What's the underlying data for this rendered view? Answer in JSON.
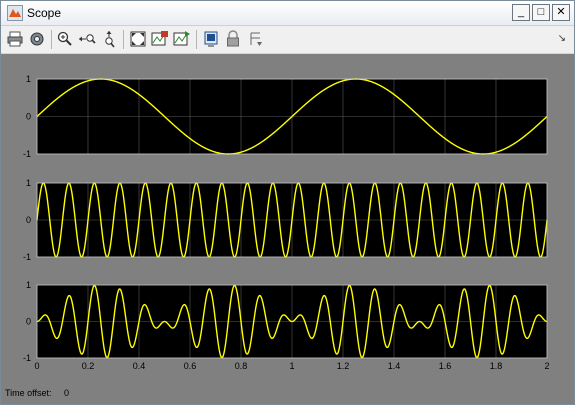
{
  "window": {
    "title": "Scope",
    "controls": [
      "_",
      "□",
      "✕"
    ]
  },
  "toolbar": {
    "buttons": [
      {
        "name": "print-button",
        "icon": "printer-icon"
      },
      {
        "name": "parameters-button",
        "icon": "gear-icon"
      },
      {
        "name": "zoom-in-button",
        "icon": "magnifier-icon"
      },
      {
        "name": "zoom-x-button",
        "icon": "zoom-x-icon"
      },
      {
        "name": "zoom-y-button",
        "icon": "zoom-y-icon"
      },
      {
        "name": "autoscale-button",
        "icon": "autoscale-icon"
      },
      {
        "name": "save-axes-button",
        "icon": "save-axes-icon"
      },
      {
        "name": "restore-axes-button",
        "icon": "restore-axes-icon"
      },
      {
        "name": "floating-scope-button",
        "icon": "floating-icon"
      },
      {
        "name": "lock-axes-button",
        "icon": "lock-icon"
      },
      {
        "name": "signal-selection-button",
        "icon": "signal-selection-icon"
      }
    ],
    "corner_glyph": "↘"
  },
  "status": {
    "time_offset_label": "Time offset:",
    "time_offset_value": "0"
  },
  "colors": {
    "plot_background": "#000000",
    "figure_background": "#808080",
    "trace": "#ffff00",
    "grid": "#5a5a5a",
    "tick_text": "#000000"
  },
  "chart_data": [
    {
      "type": "line",
      "title": "",
      "xlabel": "",
      "ylabel": "",
      "xlim": [
        0,
        2
      ],
      "ylim": [
        -1,
        1
      ],
      "xticks": [
        0,
        0.2,
        0.4,
        0.6,
        0.8,
        1,
        1.2,
        1.4,
        1.6,
        1.8,
        2
      ],
      "yticks": [
        -1,
        0,
        1
      ],
      "x_tick_labels_shown": false,
      "grid": true,
      "series": [
        {
          "function": "sin(2*pi*1*t)",
          "frequency_hz": 1,
          "amplitude": 1
        }
      ]
    },
    {
      "type": "line",
      "title": "",
      "xlabel": "",
      "ylabel": "",
      "xlim": [
        0,
        2
      ],
      "ylim": [
        -1,
        1
      ],
      "xticks": [
        0,
        0.2,
        0.4,
        0.6,
        0.8,
        1,
        1.2,
        1.4,
        1.6,
        1.8,
        2
      ],
      "yticks": [
        -1,
        0,
        1
      ],
      "x_tick_labels_shown": false,
      "grid": true,
      "series": [
        {
          "function": "sin(2*pi*10*t)",
          "frequency_hz": 10,
          "amplitude": 1
        }
      ]
    },
    {
      "type": "line",
      "title": "",
      "xlabel": "",
      "ylabel": "",
      "xlim": [
        0,
        2
      ],
      "ylim": [
        -1,
        1
      ],
      "xticks": [
        0,
        0.2,
        0.4,
        0.6,
        0.8,
        1,
        1.2,
        1.4,
        1.6,
        1.8,
        2
      ],
      "xtick_labels": [
        "0",
        "0.2",
        "0.4",
        "0.6",
        "0.8",
        "1",
        "1.2",
        "1.4",
        "1.6",
        "1.8",
        "2"
      ],
      "yticks": [
        -1,
        0,
        1
      ],
      "x_tick_labels_shown": true,
      "grid": true,
      "series": [
        {
          "function": "sin(2*pi*1*t)*sin(2*pi*10*t)",
          "components_hz": [
            1,
            10
          ]
        }
      ]
    }
  ]
}
